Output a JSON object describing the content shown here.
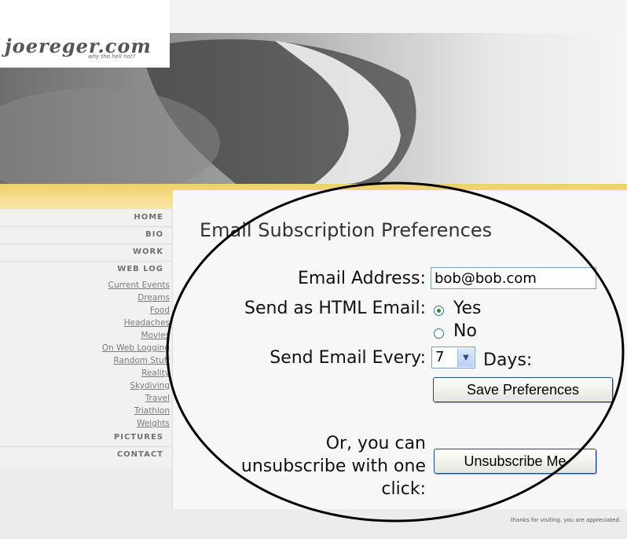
{
  "site": {
    "logo": "joereger.com",
    "tagline": "why the hell not?"
  },
  "nav": {
    "main": [
      "HOME",
      "BIO",
      "WORK",
      "WEB LOG"
    ],
    "sub": [
      "Current Events",
      "Dreams",
      "Food",
      "Headaches",
      "Movies",
      "On Web Logging",
      "Random Stuff",
      "Reality",
      "Skydiving",
      "Travel",
      "Triathlon",
      "Weights"
    ],
    "bottom": [
      "PICTURES",
      "CONTACT"
    ]
  },
  "form": {
    "title": "Email Subscription Preferences",
    "email_label": "Email Address:",
    "email_value": "bob@bob.com",
    "html_label": "Send as HTML Email:",
    "html_options": [
      "Yes",
      "No"
    ],
    "html_selected": "Yes",
    "every_label": "Send Email Every:",
    "every_value": "7",
    "days_label": "Days:",
    "save_button": "Save Preferences",
    "unsub_text": [
      "Or, you can",
      "unsubscribe with one",
      "click:"
    ],
    "unsub_button": "Unsubscribe Me"
  },
  "footer": "thanks for visiting.  you are appreciated.",
  "colors": {
    "stripe": "#f0cf6a",
    "annotation_ellipse": "#000000"
  }
}
